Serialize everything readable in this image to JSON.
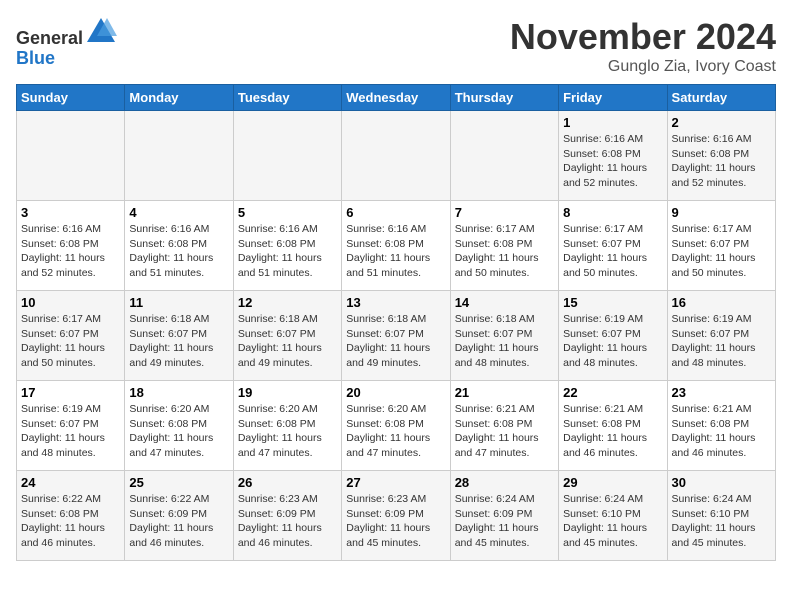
{
  "header": {
    "logo_line1": "General",
    "logo_line2": "Blue",
    "title": "November 2024",
    "subtitle": "Gunglo Zia, Ivory Coast"
  },
  "days_of_week": [
    "Sunday",
    "Monday",
    "Tuesday",
    "Wednesday",
    "Thursday",
    "Friday",
    "Saturday"
  ],
  "weeks": [
    [
      {
        "day": "",
        "sunrise": "",
        "sunset": "",
        "daylight": ""
      },
      {
        "day": "",
        "sunrise": "",
        "sunset": "",
        "daylight": ""
      },
      {
        "day": "",
        "sunrise": "",
        "sunset": "",
        "daylight": ""
      },
      {
        "day": "",
        "sunrise": "",
        "sunset": "",
        "daylight": ""
      },
      {
        "day": "",
        "sunrise": "",
        "sunset": "",
        "daylight": ""
      },
      {
        "day": "1",
        "sunrise": "Sunrise: 6:16 AM",
        "sunset": "Sunset: 6:08 PM",
        "daylight": "Daylight: 11 hours and 52 minutes."
      },
      {
        "day": "2",
        "sunrise": "Sunrise: 6:16 AM",
        "sunset": "Sunset: 6:08 PM",
        "daylight": "Daylight: 11 hours and 52 minutes."
      }
    ],
    [
      {
        "day": "3",
        "sunrise": "Sunrise: 6:16 AM",
        "sunset": "Sunset: 6:08 PM",
        "daylight": "Daylight: 11 hours and 52 minutes."
      },
      {
        "day": "4",
        "sunrise": "Sunrise: 6:16 AM",
        "sunset": "Sunset: 6:08 PM",
        "daylight": "Daylight: 11 hours and 51 minutes."
      },
      {
        "day": "5",
        "sunrise": "Sunrise: 6:16 AM",
        "sunset": "Sunset: 6:08 PM",
        "daylight": "Daylight: 11 hours and 51 minutes."
      },
      {
        "day": "6",
        "sunrise": "Sunrise: 6:16 AM",
        "sunset": "Sunset: 6:08 PM",
        "daylight": "Daylight: 11 hours and 51 minutes."
      },
      {
        "day": "7",
        "sunrise": "Sunrise: 6:17 AM",
        "sunset": "Sunset: 6:08 PM",
        "daylight": "Daylight: 11 hours and 50 minutes."
      },
      {
        "day": "8",
        "sunrise": "Sunrise: 6:17 AM",
        "sunset": "Sunset: 6:07 PM",
        "daylight": "Daylight: 11 hours and 50 minutes."
      },
      {
        "day": "9",
        "sunrise": "Sunrise: 6:17 AM",
        "sunset": "Sunset: 6:07 PM",
        "daylight": "Daylight: 11 hours and 50 minutes."
      }
    ],
    [
      {
        "day": "10",
        "sunrise": "Sunrise: 6:17 AM",
        "sunset": "Sunset: 6:07 PM",
        "daylight": "Daylight: 11 hours and 50 minutes."
      },
      {
        "day": "11",
        "sunrise": "Sunrise: 6:18 AM",
        "sunset": "Sunset: 6:07 PM",
        "daylight": "Daylight: 11 hours and 49 minutes."
      },
      {
        "day": "12",
        "sunrise": "Sunrise: 6:18 AM",
        "sunset": "Sunset: 6:07 PM",
        "daylight": "Daylight: 11 hours and 49 minutes."
      },
      {
        "day": "13",
        "sunrise": "Sunrise: 6:18 AM",
        "sunset": "Sunset: 6:07 PM",
        "daylight": "Daylight: 11 hours and 49 minutes."
      },
      {
        "day": "14",
        "sunrise": "Sunrise: 6:18 AM",
        "sunset": "Sunset: 6:07 PM",
        "daylight": "Daylight: 11 hours and 48 minutes."
      },
      {
        "day": "15",
        "sunrise": "Sunrise: 6:19 AM",
        "sunset": "Sunset: 6:07 PM",
        "daylight": "Daylight: 11 hours and 48 minutes."
      },
      {
        "day": "16",
        "sunrise": "Sunrise: 6:19 AM",
        "sunset": "Sunset: 6:07 PM",
        "daylight": "Daylight: 11 hours and 48 minutes."
      }
    ],
    [
      {
        "day": "17",
        "sunrise": "Sunrise: 6:19 AM",
        "sunset": "Sunset: 6:07 PM",
        "daylight": "Daylight: 11 hours and 48 minutes."
      },
      {
        "day": "18",
        "sunrise": "Sunrise: 6:20 AM",
        "sunset": "Sunset: 6:08 PM",
        "daylight": "Daylight: 11 hours and 47 minutes."
      },
      {
        "day": "19",
        "sunrise": "Sunrise: 6:20 AM",
        "sunset": "Sunset: 6:08 PM",
        "daylight": "Daylight: 11 hours and 47 minutes."
      },
      {
        "day": "20",
        "sunrise": "Sunrise: 6:20 AM",
        "sunset": "Sunset: 6:08 PM",
        "daylight": "Daylight: 11 hours and 47 minutes."
      },
      {
        "day": "21",
        "sunrise": "Sunrise: 6:21 AM",
        "sunset": "Sunset: 6:08 PM",
        "daylight": "Daylight: 11 hours and 47 minutes."
      },
      {
        "day": "22",
        "sunrise": "Sunrise: 6:21 AM",
        "sunset": "Sunset: 6:08 PM",
        "daylight": "Daylight: 11 hours and 46 minutes."
      },
      {
        "day": "23",
        "sunrise": "Sunrise: 6:21 AM",
        "sunset": "Sunset: 6:08 PM",
        "daylight": "Daylight: 11 hours and 46 minutes."
      }
    ],
    [
      {
        "day": "24",
        "sunrise": "Sunrise: 6:22 AM",
        "sunset": "Sunset: 6:08 PM",
        "daylight": "Daylight: 11 hours and 46 minutes."
      },
      {
        "day": "25",
        "sunrise": "Sunrise: 6:22 AM",
        "sunset": "Sunset: 6:09 PM",
        "daylight": "Daylight: 11 hours and 46 minutes."
      },
      {
        "day": "26",
        "sunrise": "Sunrise: 6:23 AM",
        "sunset": "Sunset: 6:09 PM",
        "daylight": "Daylight: 11 hours and 46 minutes."
      },
      {
        "day": "27",
        "sunrise": "Sunrise: 6:23 AM",
        "sunset": "Sunset: 6:09 PM",
        "daylight": "Daylight: 11 hours and 45 minutes."
      },
      {
        "day": "28",
        "sunrise": "Sunrise: 6:24 AM",
        "sunset": "Sunset: 6:09 PM",
        "daylight": "Daylight: 11 hours and 45 minutes."
      },
      {
        "day": "29",
        "sunrise": "Sunrise: 6:24 AM",
        "sunset": "Sunset: 6:10 PM",
        "daylight": "Daylight: 11 hours and 45 minutes."
      },
      {
        "day": "30",
        "sunrise": "Sunrise: 6:24 AM",
        "sunset": "Sunset: 6:10 PM",
        "daylight": "Daylight: 11 hours and 45 minutes."
      }
    ]
  ]
}
